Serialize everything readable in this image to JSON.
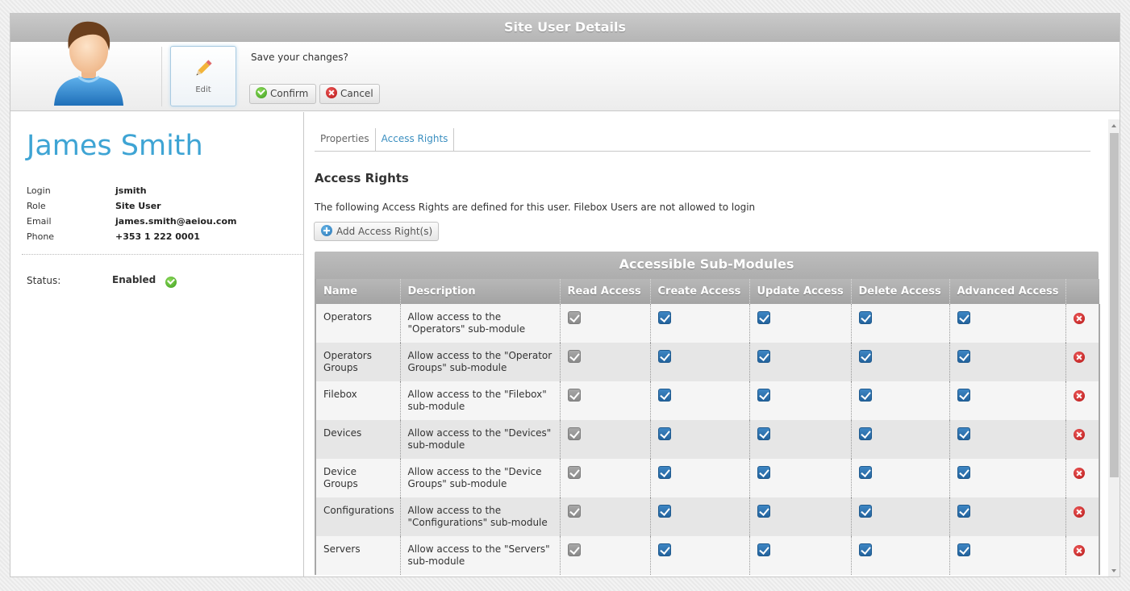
{
  "window": {
    "title": "Site User Details"
  },
  "toolbar": {
    "edit_label": "Edit",
    "prompt": "Save your changes?",
    "confirm_label": "Confirm",
    "cancel_label": "Cancel"
  },
  "user": {
    "name": "James Smith",
    "fields": [
      {
        "key": "Login",
        "value": "jsmith"
      },
      {
        "key": "Role",
        "value": "Site User"
      },
      {
        "key": "Email",
        "value": "james.smith@aeiou.com"
      },
      {
        "key": "Phone",
        "value": "+353 1 222 0001"
      }
    ],
    "status_label": "Status:",
    "status_value": "Enabled"
  },
  "tabs": [
    {
      "label": "Properties",
      "active": false
    },
    {
      "label": "Access Rights",
      "active": true
    }
  ],
  "access": {
    "title": "Access Rights",
    "description": "The following Access Rights are defined for this user. Filebox Users are not allowed to login",
    "add_label": "Add Access Right(s)",
    "grid_title": "Accessible Sub-Modules",
    "columns": [
      "Name",
      "Description",
      "Read Access",
      "Create Access",
      "Update Access",
      "Delete Access",
      "Advanced Access",
      ""
    ],
    "rows": [
      {
        "name": "Operators",
        "description": "Allow access to the \"Operators\" sub-module",
        "read": true,
        "create": true,
        "update": true,
        "delete": true,
        "advanced": true
      },
      {
        "name": "Operators Groups",
        "description": "Allow access to the \"Operator Groups\" sub-module",
        "read": true,
        "create": true,
        "update": true,
        "delete": true,
        "advanced": true
      },
      {
        "name": "Filebox",
        "description": "Allow access to the \"Filebox\" sub-module",
        "read": true,
        "create": true,
        "update": true,
        "delete": true,
        "advanced": true
      },
      {
        "name": "Devices",
        "description": "Allow access to the \"Devices\" sub-module",
        "read": true,
        "create": true,
        "update": true,
        "delete": true,
        "advanced": true
      },
      {
        "name": "Device Groups",
        "description": "Allow access to the \"Device Groups\" sub-module",
        "read": true,
        "create": true,
        "update": true,
        "delete": true,
        "advanced": true
      },
      {
        "name": "Configurations",
        "description": "Allow access to the \"Configurations\" sub-module",
        "read": true,
        "create": true,
        "update": true,
        "delete": true,
        "advanced": true
      },
      {
        "name": "Servers",
        "description": "Allow access to the \"Servers\" sub-module",
        "read": true,
        "create": true,
        "update": true,
        "delete": true,
        "advanced": true
      }
    ]
  },
  "colors": {
    "accent": "#3ea4d4",
    "checkbox_blue": "#2f74b0",
    "checkbox_grey": "#999999"
  },
  "icons": [
    "user-avatar-icon",
    "pencil-icon",
    "check-circle-icon",
    "cancel-circle-icon",
    "add-circle-icon",
    "delete-circle-icon"
  ]
}
